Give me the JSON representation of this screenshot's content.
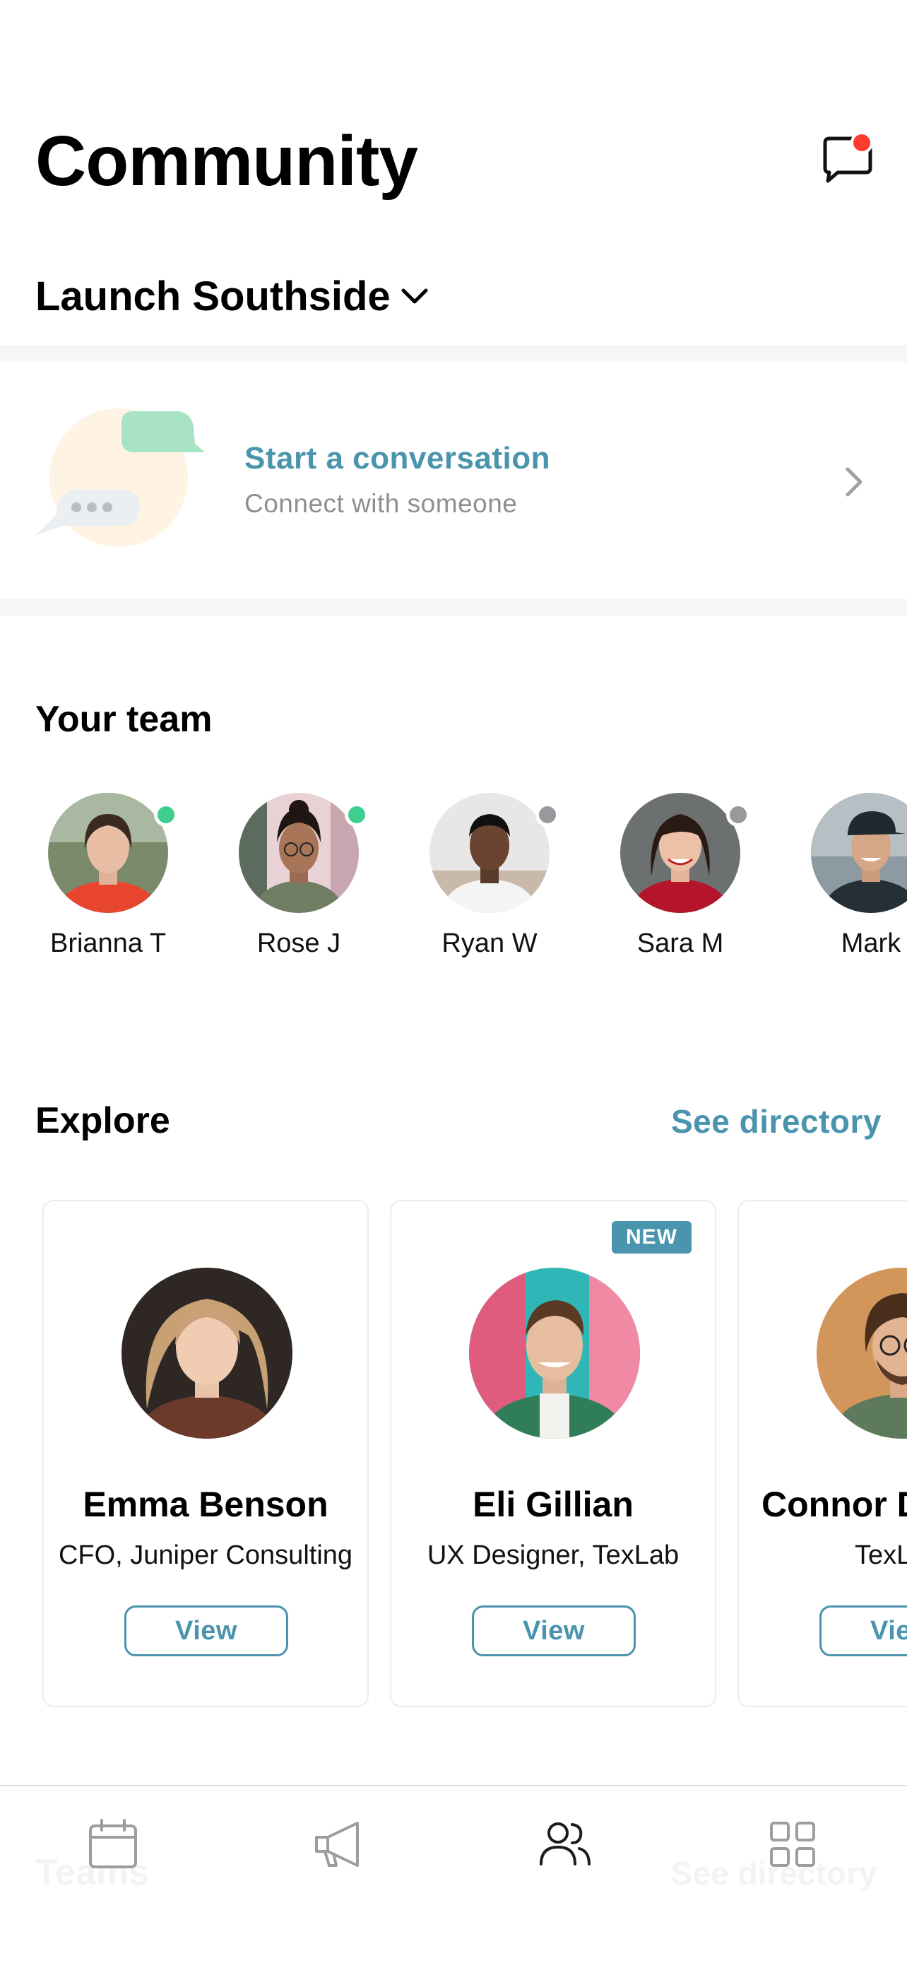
{
  "header": {
    "title": "Community",
    "org": "Launch Southside",
    "messages_icon": "chat-bubble-icon",
    "has_notification": true,
    "notification_color": "#ff3b30"
  },
  "conversation": {
    "title": "Start a conversation",
    "subtitle": "Connect with someone"
  },
  "team": {
    "title": "Your team",
    "members": [
      {
        "name": "Brianna T",
        "status": "online"
      },
      {
        "name": "Rose J",
        "status": "online"
      },
      {
        "name": "Ryan W",
        "status": "offline"
      },
      {
        "name": "Sara M",
        "status": "offline"
      },
      {
        "name": "Mark",
        "status": "offline"
      }
    ],
    "status_colors": {
      "online": "#3ecf8e",
      "offline": "#98989d"
    }
  },
  "explore": {
    "title": "Explore",
    "see_directory": "See directory",
    "cards": [
      {
        "name": "Emma Benson",
        "role": "CFO, Juniper Consulting",
        "button": "View",
        "badge": ""
      },
      {
        "name": "Eli Gillian",
        "role": "UX Designer, TexLab",
        "button": "View",
        "badge": "NEW"
      },
      {
        "name": "Connor D",
        "role": "TexL",
        "button": "View",
        "badge": ""
      }
    ]
  },
  "tabbar": {
    "tabs": [
      {
        "icon": "calendar-icon",
        "active": false
      },
      {
        "icon": "megaphone-icon",
        "active": false
      },
      {
        "icon": "people-icon",
        "active": true
      },
      {
        "icon": "grid-icon",
        "active": false
      }
    ],
    "ghost_left": "Teams",
    "ghost_right": "See directory"
  },
  "colors": {
    "accent": "#4a94ad",
    "text": "#000000",
    "muted": "#8e8e93",
    "divider": "#f6f6f7"
  }
}
